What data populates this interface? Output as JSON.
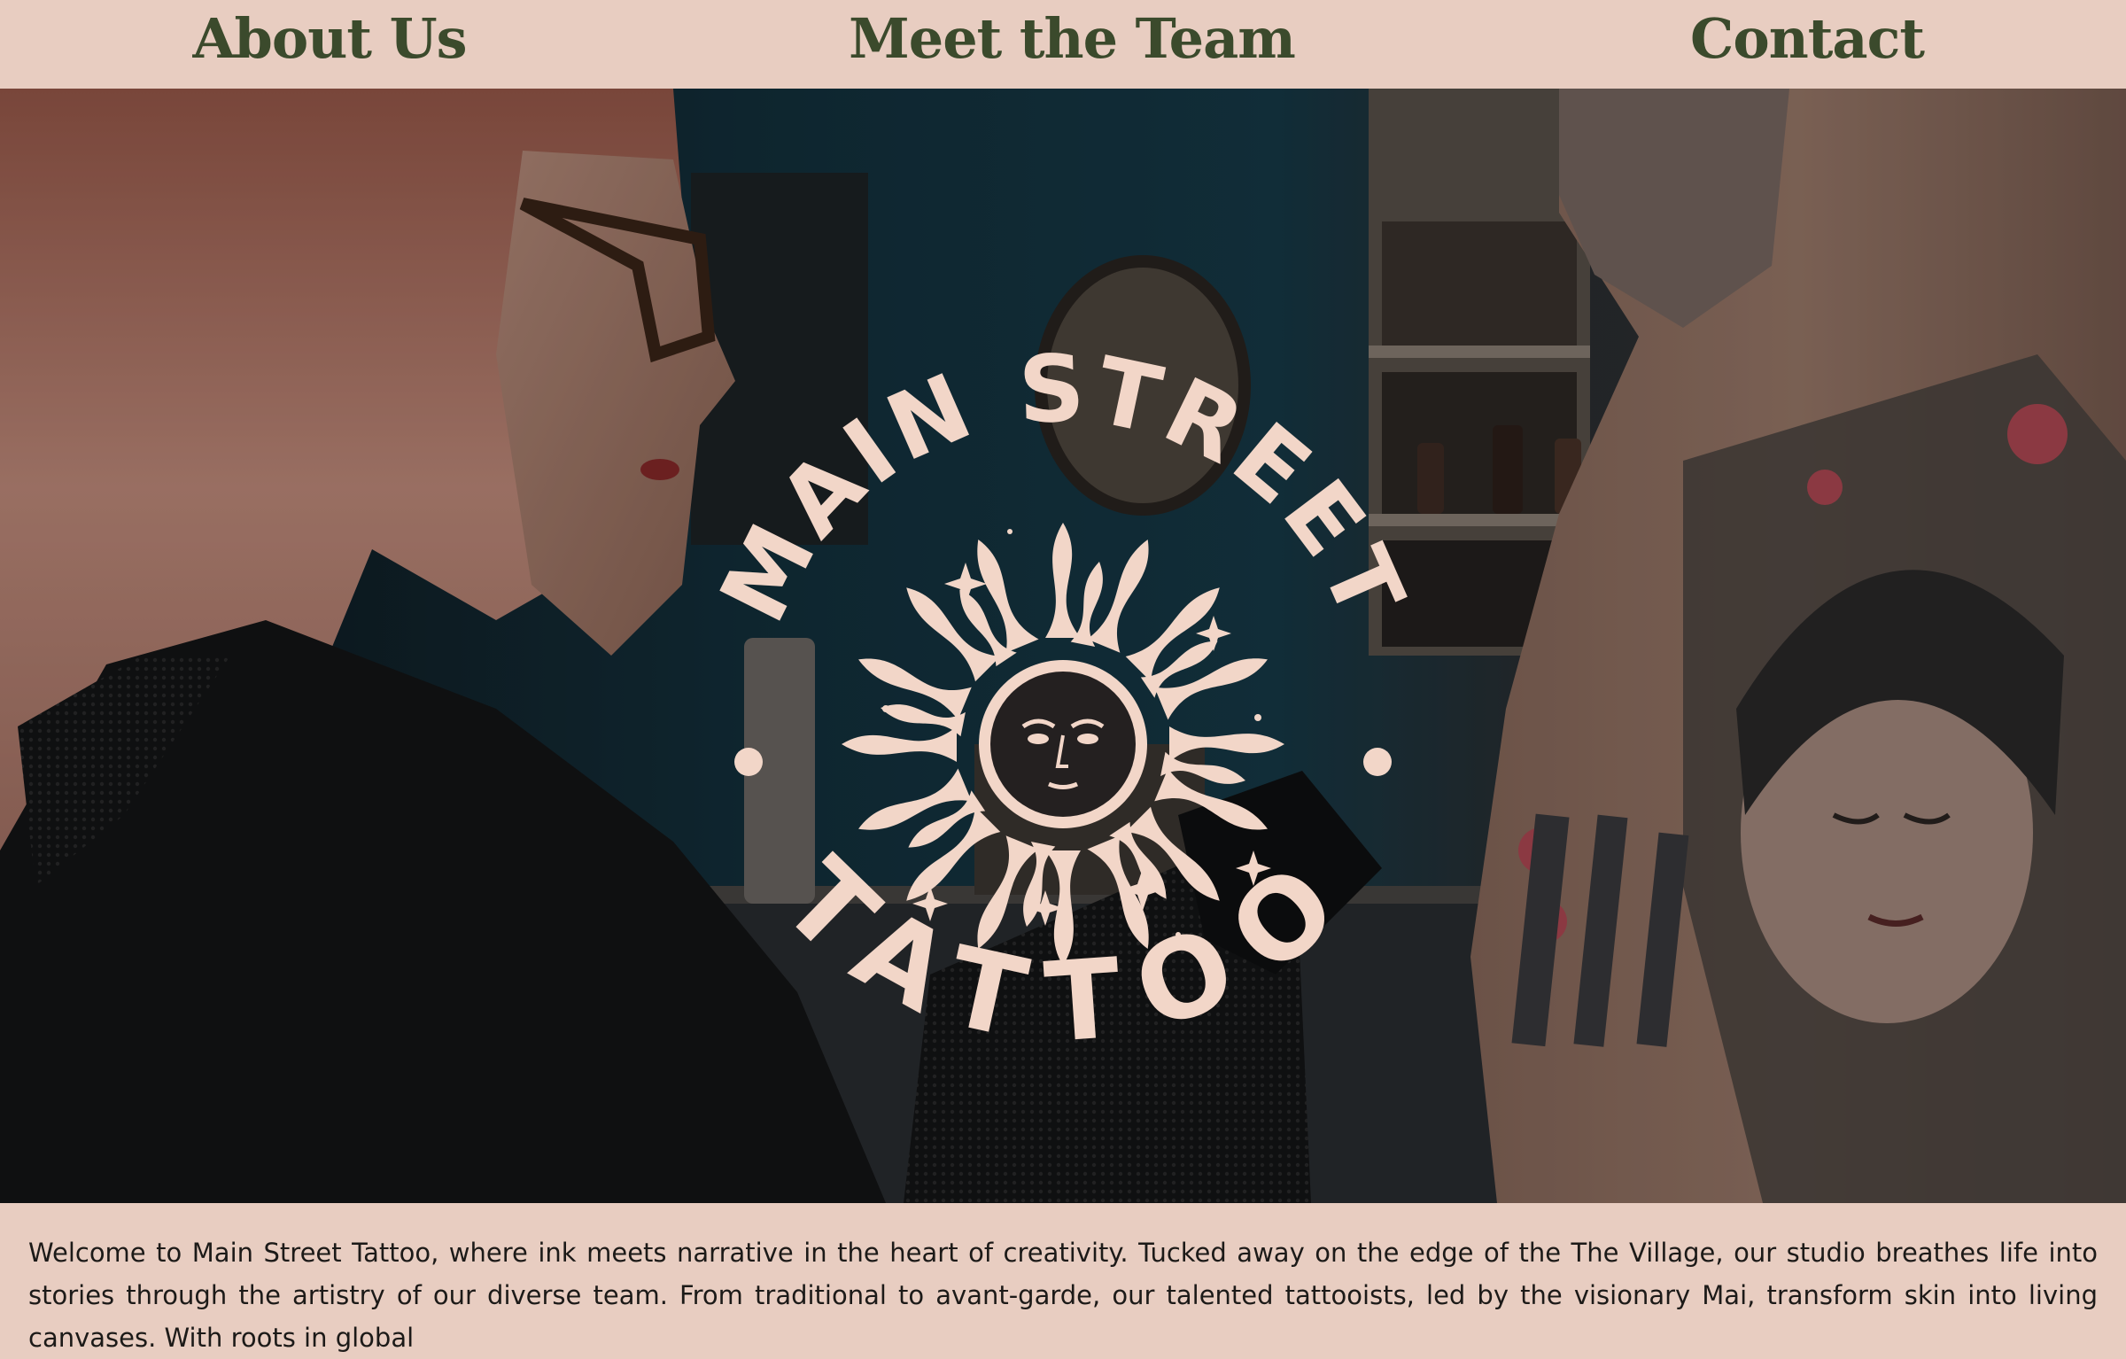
{
  "nav": {
    "about": "About Us",
    "team": "Meet the Team",
    "contact": "Contact"
  },
  "logo": {
    "top_text": "MAIN STREET",
    "bottom_text": "TATTOO"
  },
  "intro": {
    "text": "Welcome to Main Street Tattoo, where ink meets narrative in the heart of creativity. Tucked away on the edge of the The Village, our studio breathes life into stories through the artistry of our diverse team. From traditional to avant-garde, our talented tattooists, led by the visionary Mai, transform skin into living canvases. With roots in global"
  },
  "colors": {
    "background": "#e8cdc1",
    "nav_text": "#3b4a2c",
    "logo": "#f2d6c8",
    "body_text": "#1c1a18"
  },
  "icons": {
    "logo_emblem": "sun-with-face-icon"
  }
}
